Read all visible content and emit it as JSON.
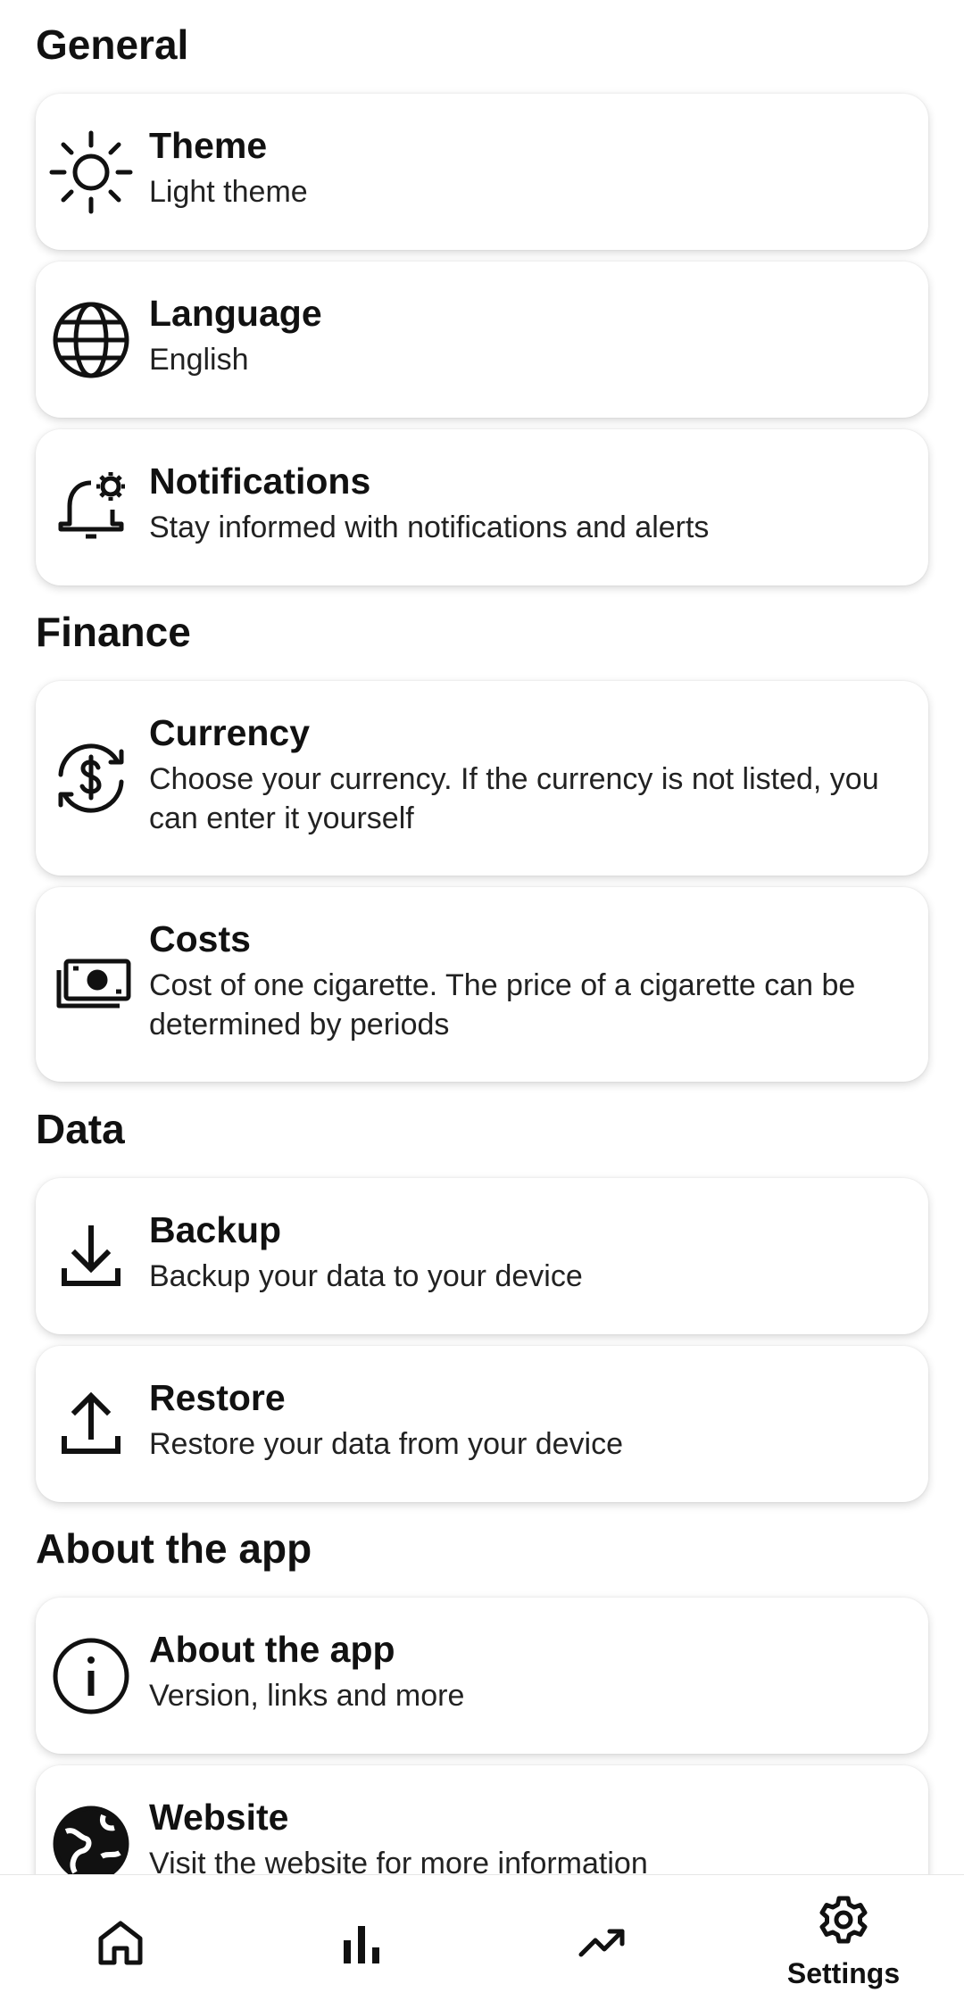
{
  "sections": [
    {
      "title": "General",
      "items": [
        {
          "title": "Theme",
          "subtitle": "Light theme",
          "icon": "sun-icon"
        },
        {
          "title": "Language",
          "subtitle": "English",
          "icon": "globe-icon"
        },
        {
          "title": "Notifications",
          "subtitle": "Stay informed with notifications and alerts",
          "icon": "bell-gear-icon"
        }
      ]
    },
    {
      "title": "Finance",
      "items": [
        {
          "title": "Currency",
          "subtitle": "Choose your currency. If the currency is not listed, you can enter it yourself",
          "icon": "currency-exchange-icon"
        },
        {
          "title": "Costs",
          "subtitle": "Cost of one cigarette. The price of a cigarette can be determined by periods",
          "icon": "cash-icon"
        }
      ]
    },
    {
      "title": "Data",
      "items": [
        {
          "title": "Backup",
          "subtitle": "Backup your data to your device",
          "icon": "download-icon"
        },
        {
          "title": "Restore",
          "subtitle": "Restore your data from your device",
          "icon": "upload-icon"
        }
      ]
    },
    {
      "title": "About the app",
      "items": [
        {
          "title": "About the app",
          "subtitle": "Version, links and more",
          "icon": "info-icon"
        },
        {
          "title": "Website",
          "subtitle": "Visit the website for more information",
          "icon": "public-globe-icon"
        }
      ]
    }
  ],
  "bottom_nav": {
    "items": [
      {
        "icon": "home-icon",
        "label": ""
      },
      {
        "icon": "bar-chart-icon",
        "label": ""
      },
      {
        "icon": "trending-up-icon",
        "label": ""
      },
      {
        "icon": "settings-icon",
        "label": "Settings",
        "selected": true
      }
    ]
  }
}
